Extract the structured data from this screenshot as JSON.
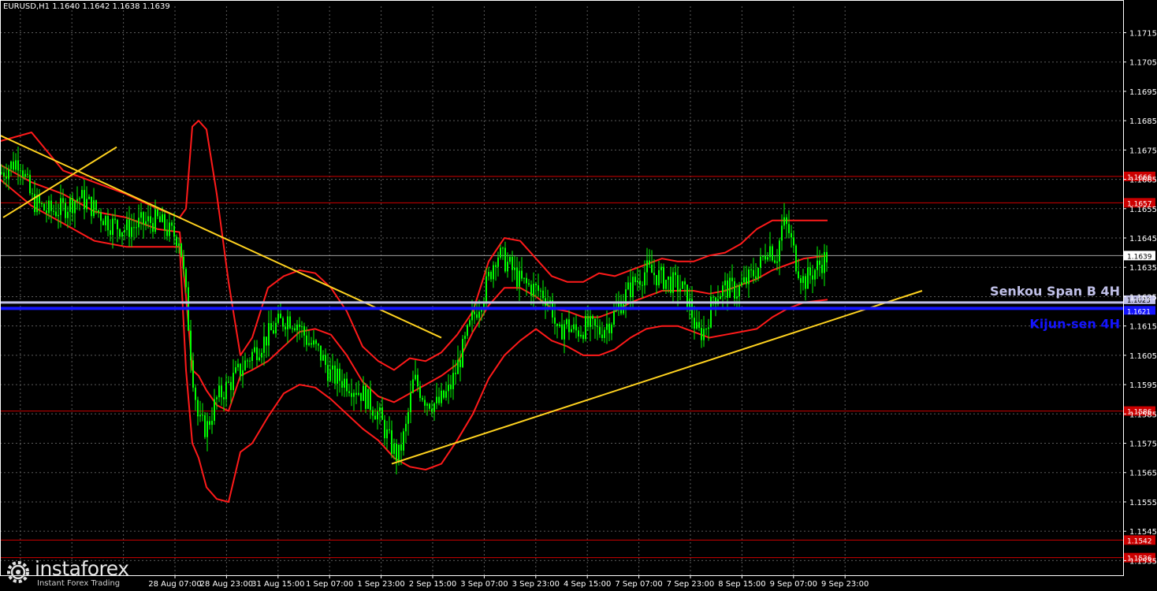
{
  "window": {
    "symbol_title": "EURUSD,H1  1.1640 1.1642 1.1638 1.1639"
  },
  "watermark": {
    "brand": "instaforex",
    "tagline": "Instant Forex Trading"
  },
  "colors": {
    "background": "#000000",
    "grid": "#5a5a5a",
    "axis": "#ffffff",
    "candles": "#00ff00",
    "bands": "#ff1a1a",
    "levels": "#cc0000",
    "trendlines": "#ffd21f",
    "kijun": "#1414ff",
    "senkou": "#c0c0e8",
    "price_line": "#a0a0a0"
  },
  "chart_data": {
    "type": "line",
    "title": "EURUSD,H1  1.1640 1.1642 1.1638 1.1639",
    "symbol": "EURUSD",
    "timeframe": "H1",
    "ohlc_last": {
      "open": 1.164,
      "high": 1.1642,
      "low": 1.1638,
      "close": 1.1639
    },
    "ylim": [
      1.153,
      1.1724
    ],
    "grid": true,
    "y_ticks": [
      "1.1715",
      "1.1705",
      "1.1695",
      "1.1685",
      "1.1675",
      "1.1665",
      "1.1655",
      "1.1645",
      "1.1635",
      "1.1625",
      "1.1615",
      "1.1605",
      "1.1595",
      "1.1585",
      "1.1575",
      "1.1565",
      "1.1555",
      "1.1545",
      "1.1535"
    ],
    "x_ticks": [
      "28 Aug 07:00",
      "28 Aug 23:00",
      "31 Aug 15:00",
      "1 Sep 07:00",
      "1 Sep 23:00",
      "2 Sep 15:00",
      "3 Sep 07:00",
      "3 Sep 23:00",
      "4 Sep 15:00",
      "7 Sep 07:00",
      "7 Sep 23:00",
      "8 Sep 15:00",
      "9 Sep 07:00",
      "9 Sep 23:00"
    ],
    "current_price": "1.1639",
    "levels": [
      {
        "value": 1.1666,
        "label": "1.1666",
        "kind": "resistance"
      },
      {
        "value": 1.1657,
        "label": "1.1657",
        "kind": "resistance"
      },
      {
        "value": 1.1586,
        "label": "1.1586",
        "kind": "support"
      },
      {
        "value": 1.1542,
        "label": "1.1542",
        "kind": "support"
      },
      {
        "value": 1.1536,
        "label": "1.1536",
        "kind": "support"
      }
    ],
    "ichimoku": [
      {
        "name": "Senkou Span B 4H",
        "value": 1.1623,
        "label": "1.1623"
      },
      {
        "name": "Kijun-sen 4H",
        "value": 1.1621,
        "label": "1.1621"
      }
    ],
    "trendlines": [
      {
        "points": [
          [
            "26 Aug",
            1.168
          ],
          [
            "1 Sep 23:00+",
            1.1611
          ]
        ]
      },
      {
        "points": [
          [
            "26 Aug",
            1.1652
          ],
          [
            "27 Aug",
            1.1676
          ]
        ]
      },
      {
        "points": [
          [
            "2 Sep 03:00",
            1.1568
          ],
          [
            "10 Sep",
            1.1627
          ]
        ]
      }
    ],
    "price_series": {
      "name": "",
      "x": [
        0,
        25,
        40,
        60,
        80,
        100,
        120,
        140,
        160,
        180,
        200,
        215,
        228,
        236,
        244,
        252,
        262,
        275,
        290,
        305,
        318,
        335,
        350,
        365,
        378,
        390,
        405,
        420,
        440,
        460,
        480,
        495,
        505,
        515,
        525,
        540,
        555,
        570,
        585,
        600,
        615,
        630,
        645,
        660,
        675,
        690,
        700,
        708,
        715,
        730,
        745,
        760,
        775,
        790,
        805,
        820,
        835,
        850,
        865,
        875,
        885,
        895,
        905,
        920,
        935,
        950,
        965,
        975,
        985,
        993,
        1000,
        1010,
        1020,
        1030,
        1040,
        1050
      ],
      "values": [
        1.1667,
        1.1672,
        1.1658,
        1.1654,
        1.1655,
        1.1659,
        1.1655,
        1.165,
        1.1648,
        1.165,
        1.1651,
        1.1647,
        1.1645,
        1.1625,
        1.16,
        1.1582,
        1.158,
        1.159,
        1.1595,
        1.16,
        1.1605,
        1.161,
        1.1615,
        1.1618,
        1.1616,
        1.161,
        1.1606,
        1.1598,
        1.1596,
        1.1592,
        1.1585,
        1.1575,
        1.157,
        1.158,
        1.1597,
        1.159,
        1.1588,
        1.1593,
        1.1605,
        1.1618,
        1.1627,
        1.164,
        1.1636,
        1.163,
        1.1628,
        1.1626,
        1.1622,
        1.161,
        1.1616,
        1.1613,
        1.1615,
        1.1613,
        1.1617,
        1.1624,
        1.163,
        1.1634,
        1.1632,
        1.163,
        1.1628,
        1.1622,
        1.1612,
        1.1614,
        1.1625,
        1.1628,
        1.1627,
        1.1631,
        1.1636,
        1.1643,
        1.1638,
        1.165,
        1.1648,
        1.1637,
        1.163,
        1.1633,
        1.1636,
        1.1639
      ]
    },
    "bands": [
      {
        "name": "",
        "x": [
          0,
          40,
          80,
          120,
          160,
          200,
          228,
          236,
          244,
          252,
          262,
          275,
          290,
          305,
          320,
          340,
          360,
          380,
          400,
          420,
          440,
          460,
          480,
          500,
          520,
          540,
          560,
          580,
          600,
          620,
          640,
          660,
          680,
          700,
          720,
          740,
          760,
          780,
          800,
          820,
          840,
          860,
          880,
          900,
          920,
          940,
          960,
          980,
          1000,
          1020,
          1050
        ],
        "values": [
          1.1678,
          1.1681,
          1.1668,
          1.1664,
          1.166,
          1.1655,
          1.1652,
          1.1655,
          1.1683,
          1.1685,
          1.1682,
          1.166,
          1.163,
          1.1605,
          1.1611,
          1.1628,
          1.1632,
          1.1634,
          1.1633,
          1.1628,
          1.162,
          1.1608,
          1.1603,
          1.16,
          1.1604,
          1.1603,
          1.1606,
          1.1612,
          1.162,
          1.1637,
          1.1645,
          1.1644,
          1.1638,
          1.1632,
          1.163,
          1.163,
          1.1633,
          1.1632,
          1.1634,
          1.1636,
          1.1638,
          1.1637,
          1.1637,
          1.1639,
          1.164,
          1.1643,
          1.1648,
          1.1651,
          1.1651,
          1.1651,
          1.1651
        ]
      },
      {
        "name": "",
        "x": [
          0,
          40,
          80,
          120,
          160,
          200,
          228,
          236,
          244,
          252,
          262,
          275,
          290,
          305,
          320,
          340,
          360,
          380,
          400,
          420,
          440,
          460,
          480,
          500,
          520,
          540,
          560,
          580,
          600,
          620,
          640,
          660,
          680,
          700,
          720,
          740,
          760,
          780,
          800,
          820,
          840,
          860,
          880,
          900,
          920,
          940,
          960,
          980,
          1000,
          1020,
          1050
        ],
        "values": [
          1.167,
          1.1664,
          1.166,
          1.1654,
          1.1652,
          1.1648,
          1.1647,
          1.1625,
          1.16,
          1.1598,
          1.1593,
          1.1588,
          1.1586,
          1.1598,
          1.16,
          1.1603,
          1.1608,
          1.1613,
          1.1614,
          1.1612,
          1.1605,
          1.1596,
          1.1591,
          1.1589,
          1.1592,
          1.1595,
          1.1598,
          1.1602,
          1.1613,
          1.1622,
          1.1628,
          1.1628,
          1.1625,
          1.1621,
          1.162,
          1.1618,
          1.1618,
          1.162,
          1.1623,
          1.1625,
          1.1627,
          1.1627,
          1.1627,
          1.1626,
          1.1627,
          1.1629,
          1.1631,
          1.1634,
          1.1636,
          1.1638,
          1.1639
        ]
      },
      {
        "name": "",
        "x": [
          0,
          40,
          80,
          120,
          160,
          200,
          228,
          236,
          244,
          252,
          262,
          275,
          290,
          305,
          320,
          340,
          360,
          380,
          400,
          420,
          440,
          460,
          480,
          500,
          520,
          540,
          560,
          580,
          600,
          620,
          640,
          660,
          680,
          700,
          720,
          740,
          760,
          780,
          800,
          820,
          840,
          860,
          880,
          900,
          920,
          940,
          960,
          980,
          1000,
          1020,
          1050
        ],
        "values": [
          1.1665,
          1.1656,
          1.165,
          1.1644,
          1.1642,
          1.1642,
          1.1642,
          1.16,
          1.1575,
          1.157,
          1.156,
          1.1556,
          1.1555,
          1.1572,
          1.1575,
          1.1584,
          1.1592,
          1.1595,
          1.1594,
          1.159,
          1.1585,
          1.158,
          1.1576,
          1.157,
          1.1567,
          1.1566,
          1.1568,
          1.1576,
          1.1585,
          1.1597,
          1.1605,
          1.161,
          1.1614,
          1.161,
          1.1608,
          1.1605,
          1.1605,
          1.1607,
          1.1611,
          1.1614,
          1.1615,
          1.1615,
          1.1613,
          1.1611,
          1.1612,
          1.1613,
          1.1614,
          1.1618,
          1.1621,
          1.1623,
          1.1624
        ]
      }
    ]
  }
}
